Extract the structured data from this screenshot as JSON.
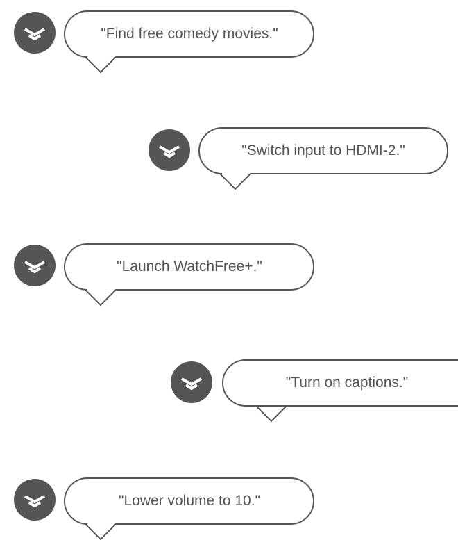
{
  "accent_color": "#555555",
  "icon": "vizio-v-chevron-icon",
  "commands": [
    {
      "text": "\"Find free comedy movies.\""
    },
    {
      "text": "\"Switch input to HDMI-2.\""
    },
    {
      "text": "\"Launch WatchFree+.\""
    },
    {
      "text": "\"Turn on captions.\""
    },
    {
      "text": "\"Lower volume to 10.\""
    }
  ]
}
